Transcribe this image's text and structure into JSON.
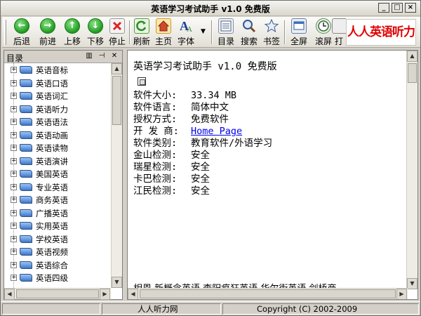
{
  "window": {
    "title": "英语学习考试助手 v1.0 免费版",
    "minimize": "_",
    "maximize": "□",
    "close": "×"
  },
  "toolbar": {
    "back": "后退",
    "forward": "前进",
    "up": "上移",
    "down": "下移",
    "stop": "停止",
    "refresh": "刷新",
    "home": "主页",
    "font": "字体",
    "directory": "目录",
    "search": "搜索",
    "bookmark": "书签",
    "fullscreen": "全屏",
    "scroll": "滚屏",
    "print_partial": "打",
    "logo_text": "人人英语听力"
  },
  "sidebar": {
    "title": "目录",
    "items": [
      {
        "label": "英语音标"
      },
      {
        "label": "英语口语"
      },
      {
        "label": "英语词汇"
      },
      {
        "label": "英语听力"
      },
      {
        "label": "英语语法"
      },
      {
        "label": "英语动画"
      },
      {
        "label": "英语读物"
      },
      {
        "label": "英语演讲"
      },
      {
        "label": "美国英语"
      },
      {
        "label": "专业英语"
      },
      {
        "label": "商务英语"
      },
      {
        "label": "广播英语"
      },
      {
        "label": "实用英语"
      },
      {
        "label": "学校英语"
      },
      {
        "label": "英语视频"
      },
      {
        "label": "英语综合"
      },
      {
        "label": "英语四级"
      }
    ]
  },
  "content": {
    "heading": "英语学习考试助手 v1.0 免费版",
    "info": [
      {
        "key": "软件大小:",
        "value": "33.34 MB"
      },
      {
        "key": "软件语言:",
        "value": "简体中文"
      },
      {
        "key": "授权方式:",
        "value": "免费软件"
      },
      {
        "key": "开 发 商:",
        "value": "Home Page",
        "link": true
      },
      {
        "key": "软件类别:",
        "value": "教育软件/外语学习"
      },
      {
        "key": "金山检测:",
        "value": "安全"
      },
      {
        "key": "瑞星检测:",
        "value": "安全"
      },
      {
        "key": "卡巴检测:",
        "value": "安全"
      },
      {
        "key": "江民检测:",
        "value": "安全"
      }
    ],
    "bottom_text": "相恩  新概念英语  李阳疯狂英语  华尔街英语  剑桥商"
  },
  "statusbar": {
    "site": "人人听力网",
    "copyright": "Copyright (C) 2002-2009"
  }
}
